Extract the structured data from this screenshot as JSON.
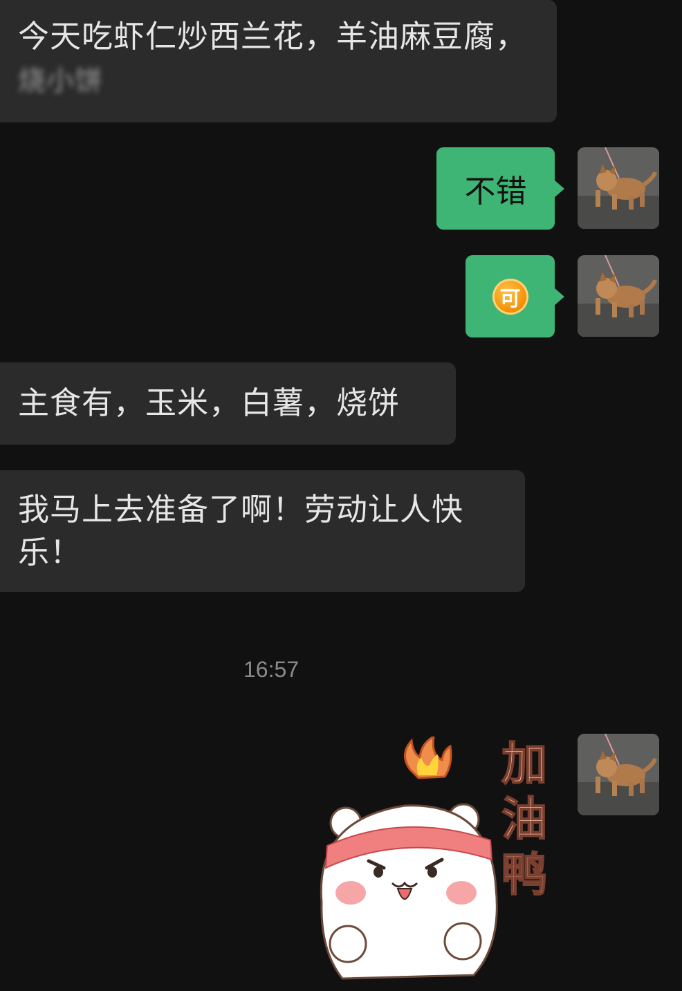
{
  "messages": [
    {
      "side": "in",
      "text_line1": "今天吃虾仁炒西兰花，羊油麻豆腐，",
      "text_line2": "烧小饼"
    },
    {
      "side": "out",
      "text": "不错"
    },
    {
      "side": "out",
      "emoji": "可"
    },
    {
      "side": "in",
      "text": "主食有，玉米，白薯，烧饼"
    },
    {
      "side": "in",
      "text_line1": "我马上去准备了啊！劳动让人快",
      "text_line2": "乐！"
    }
  ],
  "timestamp": "16:57",
  "sticker": {
    "caption_1": "加",
    "caption_2": "油",
    "caption_3": "鸭"
  },
  "colors": {
    "background": "#111111",
    "incoming_bubble": "#2b2b2b",
    "outgoing_bubble": "#3eb575"
  },
  "icons": {
    "avatar": "dog-avatar-icon",
    "sticker": "cheer-bear-sticker-icon",
    "emoji": "coin-emoji-icon"
  }
}
